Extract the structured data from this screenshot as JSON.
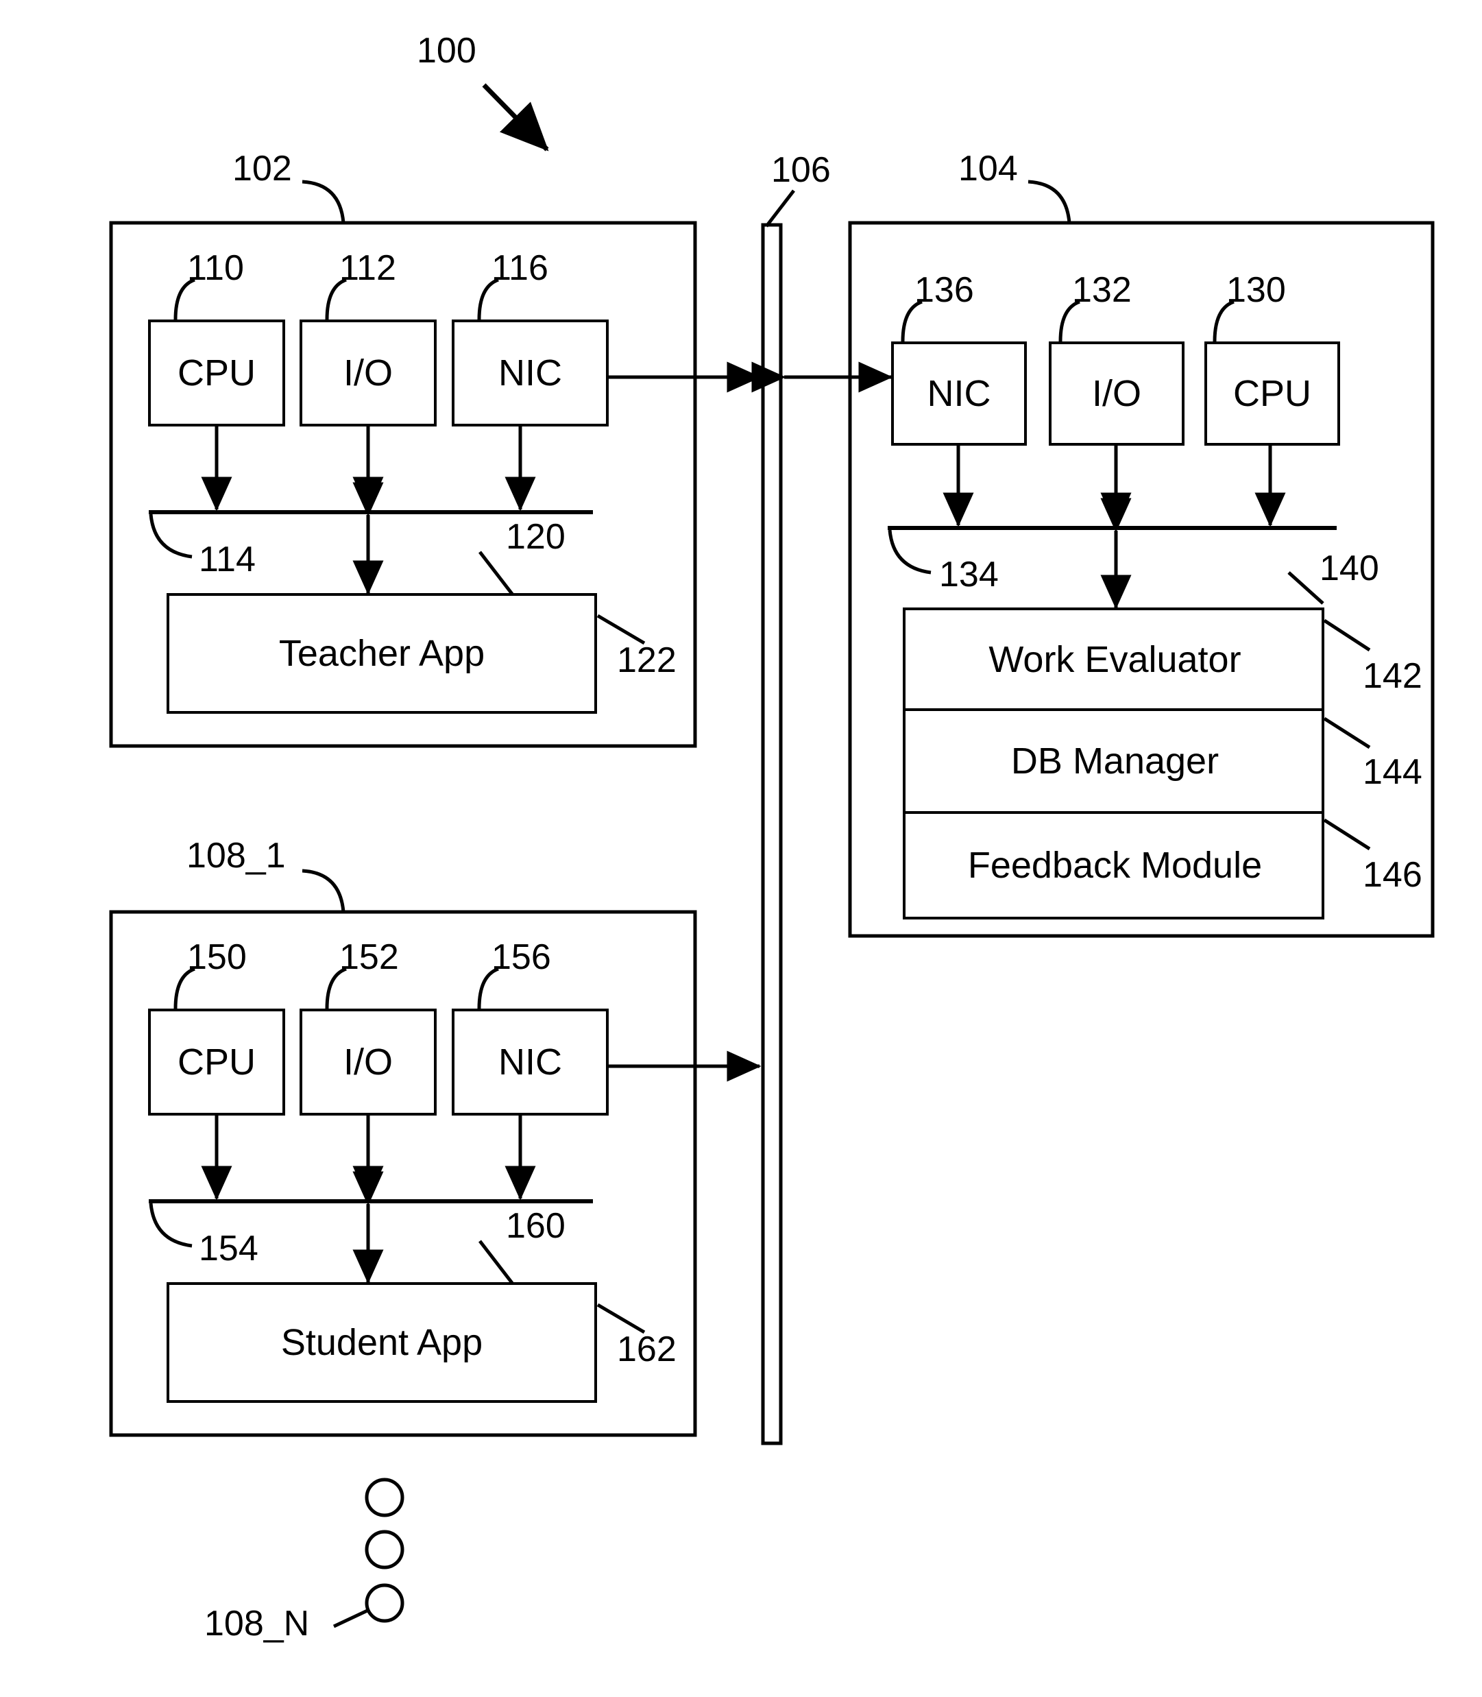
{
  "figure": {
    "system": {
      "ref": "100"
    }
  },
  "teacher_device": {
    "ref": "102",
    "components": [
      {
        "label": "CPU",
        "ref": "110"
      },
      {
        "label": "I/O",
        "ref": "112"
      },
      {
        "label": "NIC",
        "ref": "116"
      }
    ],
    "bus_ref": "114",
    "app": {
      "label": "Teacher App",
      "ref_top": "120",
      "ref_side": "122"
    }
  },
  "network": {
    "ref": "106"
  },
  "server": {
    "ref": "104",
    "components": [
      {
        "label": "NIC",
        "ref": "136"
      },
      {
        "label": "I/O",
        "ref": "132"
      },
      {
        "label": "CPU",
        "ref": "130"
      }
    ],
    "bus_ref": "134",
    "stack": {
      "ref": "140",
      "modules": [
        {
          "label": "Work Evaluator",
          "ref": "142"
        },
        {
          "label": "DB Manager",
          "ref": "144"
        },
        {
          "label": "Feedback Module",
          "ref": "146"
        }
      ]
    }
  },
  "student_device": {
    "ref": "108_1",
    "components": [
      {
        "label": "CPU",
        "ref": "150"
      },
      {
        "label": "I/O",
        "ref": "152"
      },
      {
        "label": "NIC",
        "ref": "156"
      }
    ],
    "bus_ref": "154",
    "app": {
      "label": "Student App",
      "ref_top": "160",
      "ref_side": "162"
    }
  },
  "more_students": {
    "ref": "108_N"
  }
}
